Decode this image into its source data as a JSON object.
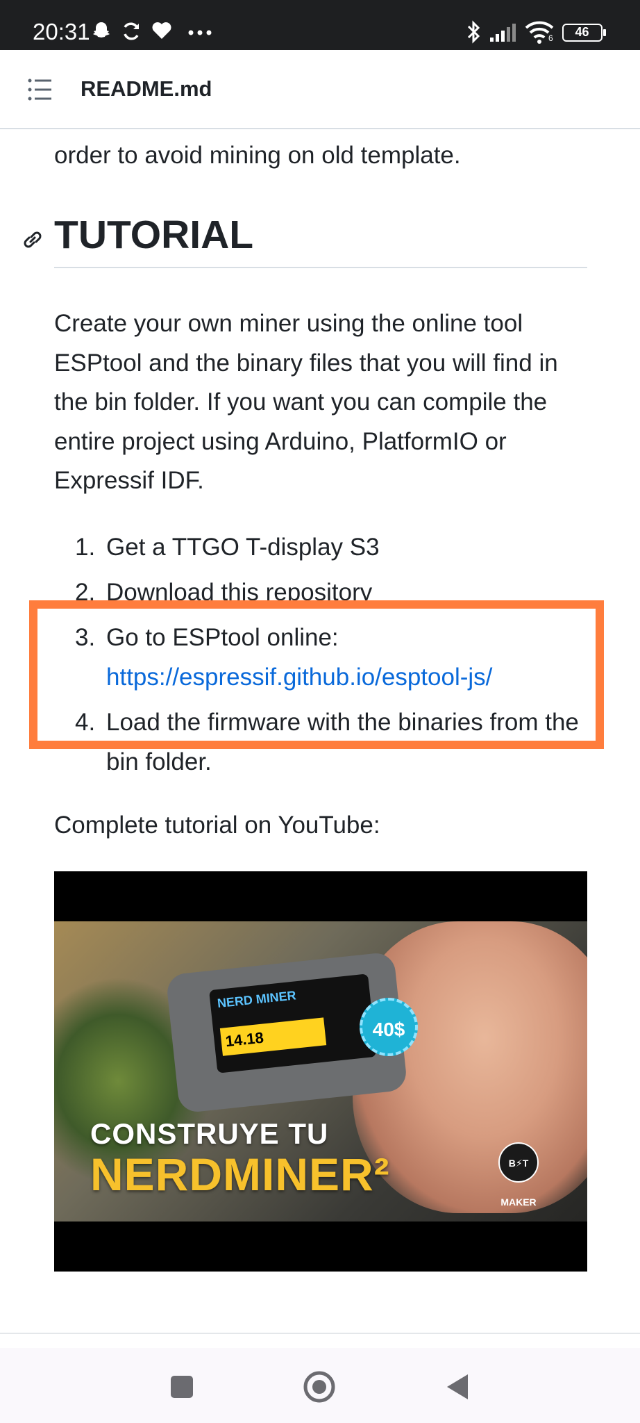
{
  "status_bar": {
    "time": "20:31",
    "left_icons": [
      "snapchat-icon",
      "sync-icon",
      "heart-icon",
      "more-dots-icon"
    ],
    "right_icons": [
      "bluetooth-icon",
      "signal-icon",
      "wifi-icon"
    ],
    "wifi_label": "6",
    "battery": "46"
  },
  "header": {
    "menu_icon": "list-icon",
    "title": "README.md"
  },
  "content": {
    "cut_text": "order to avoid mining on old template.",
    "heading": "TUTORIAL",
    "heading_icon": "link-icon",
    "paragraph": "Create your own miner using the online tool ESPtool and the binary files that you will find in the bin folder. If you want you can compile the entire project using Arduino, PlatformIO or Expressif IDF.",
    "steps": [
      {
        "num": "1.",
        "text": "Get a TTGO T-display S3"
      },
      {
        "num": "2.",
        "text": "Download this repository"
      },
      {
        "num": "3.",
        "text": "Go to ESPtool online:",
        "link": "https://espressif.github.io/esptool-js/"
      },
      {
        "num": "4.",
        "text": "Load the firmware with the binaries from the bin folder."
      }
    ],
    "youtube_label": "Complete tutorial on YouTube:",
    "video": {
      "title_line1": "CONSTRUYE TU",
      "title_line2": "NERDMINER²",
      "price": "40$",
      "screen_label": "NERD MINER",
      "screen_value": "14.18",
      "badge": "B⚡T MAKER"
    }
  },
  "colors": {
    "highlight": "#ff7d3d",
    "link": "#0969da"
  },
  "nav_bar": {
    "buttons": [
      "recents-button",
      "home-button",
      "back-button"
    ]
  }
}
